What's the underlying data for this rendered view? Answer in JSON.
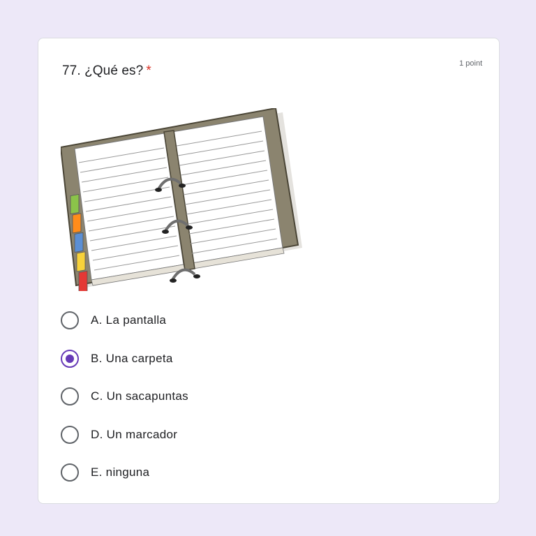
{
  "question": {
    "number_title": "77. ¿Qué es?",
    "required_marker": "*",
    "points": "1 point"
  },
  "image": {
    "icon": "planner-notebook-illustration"
  },
  "options": [
    {
      "label": "A. La pantalla",
      "selected": false
    },
    {
      "label": "B. Una carpeta",
      "selected": true
    },
    {
      "label": "C. Un sacapuntas",
      "selected": false
    },
    {
      "label": "D. Un marcador",
      "selected": false
    },
    {
      "label": "E. ninguna",
      "selected": false
    }
  ],
  "colors": {
    "background": "#ede8f8",
    "accent": "#673ab7",
    "required": "#d93025"
  }
}
